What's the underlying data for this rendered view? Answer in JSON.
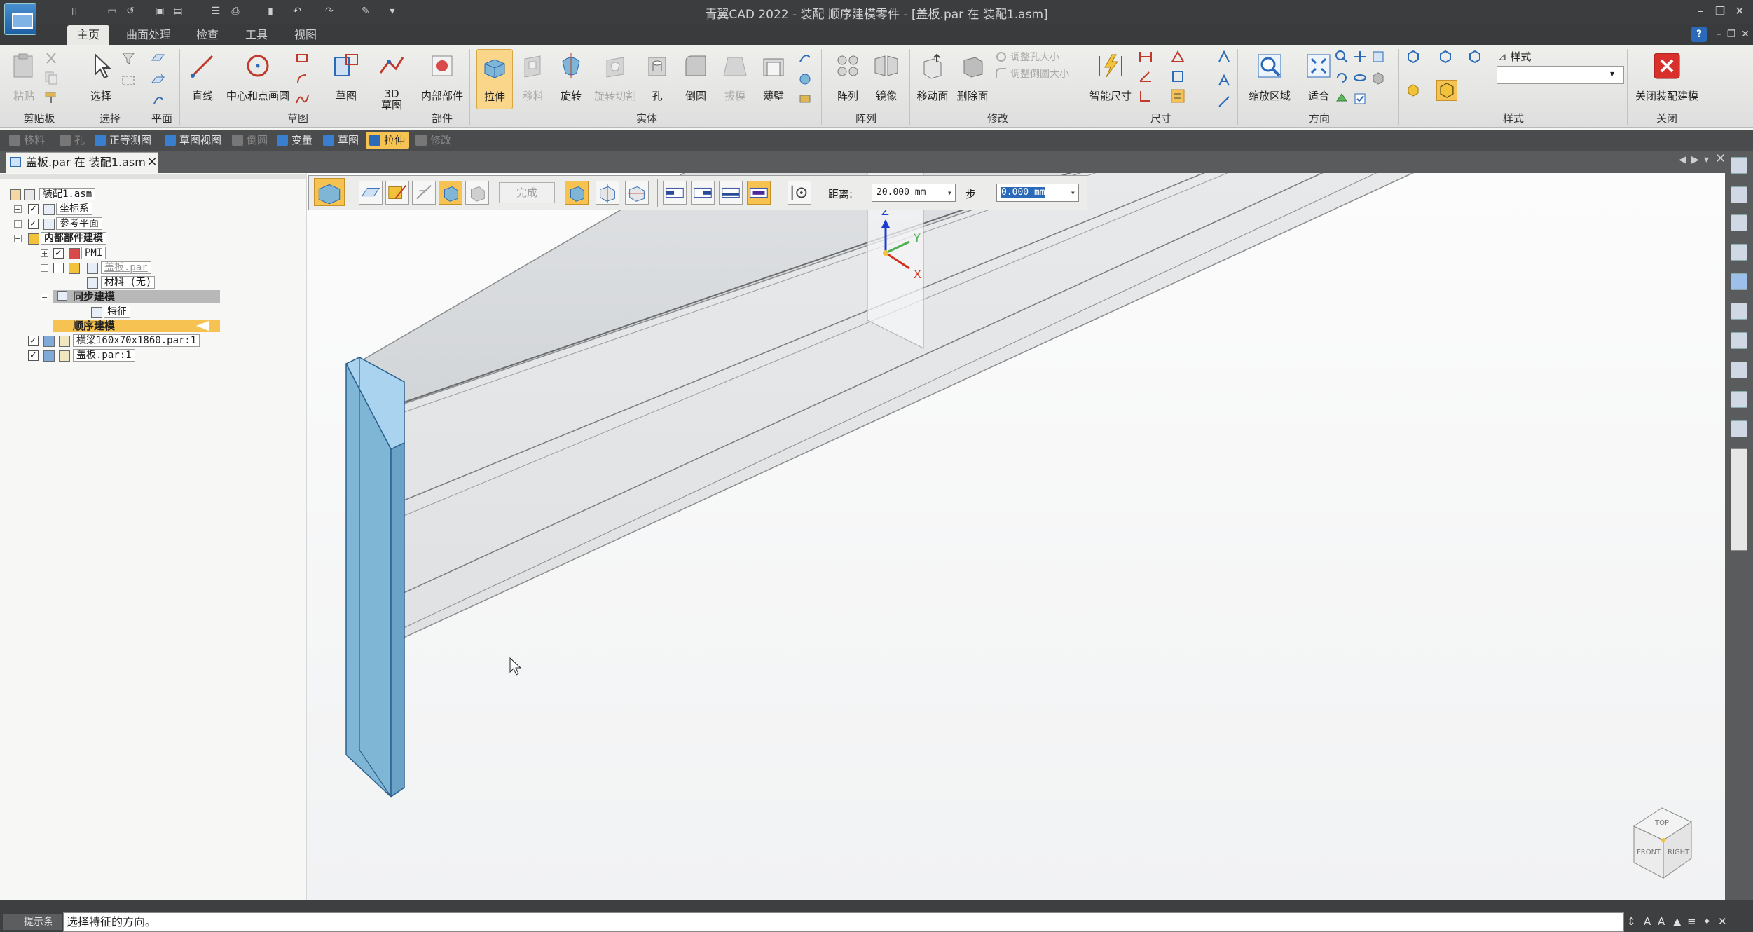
{
  "title_bar": {
    "title": "青翼CAD 2022 - 装配 顺序建模零件 - [盖板.par 在 装配1.asm]",
    "controls": [
      "–",
      "❐",
      "✕"
    ],
    "inner_controls": [
      "–",
      "❐",
      "✕"
    ]
  },
  "ribbon_tabs": [
    {
      "label": "主页",
      "active": true
    },
    {
      "label": "曲面处理"
    },
    {
      "label": "检查"
    },
    {
      "label": "工具"
    },
    {
      "label": "视图"
    }
  ],
  "ribbon": {
    "clipboard": {
      "group": "剪贴板",
      "paste": "粘贴"
    },
    "select": {
      "group": "选择",
      "select": "选择"
    },
    "plane": {
      "group": "平面"
    },
    "sketch_group": {
      "group": "草图",
      "line": "直线",
      "center_circle": "中心和点画圆",
      "sketch": "草图",
      "sketch3d": "3D\n草图"
    },
    "component": {
      "group": "部件",
      "internal": "内部部件"
    },
    "solid": {
      "group": "实体",
      "extrude": "拉伸",
      "loft": "移料",
      "revolve": "旋转",
      "revolve_cut": "旋转切割",
      "hole": "孔",
      "round": "倒圆",
      "draft": "拔模",
      "thin_wall": "薄壁"
    },
    "pattern": {
      "group": "阵列",
      "pattern": "阵列",
      "mirror": "镜像"
    },
    "modify": {
      "group": "修改",
      "move_face": "移动面",
      "delete_face": "删除面",
      "resize_hole": "调整孔大小",
      "resize_round": "调整倒圆大小"
    },
    "dimension": {
      "group": "尺寸",
      "smart_dim": "智能尺寸"
    },
    "orient": {
      "group": "方向",
      "zoom_area": "缩放区域",
      "fit": "适合"
    },
    "style": {
      "group": "样式",
      "style_label": "样式",
      "style_value": ""
    },
    "close": {
      "group": "关闭",
      "close_assembly_modeling": "关闭装配建模"
    }
  },
  "command_bar": [
    {
      "label": "移料",
      "enabled": false
    },
    {
      "label": "孔",
      "enabled": false
    },
    {
      "label": "正等测图",
      "enabled": true
    },
    {
      "label": "草图视图",
      "enabled": true
    },
    {
      "label": "倒圆",
      "enabled": false
    },
    {
      "label": "变量",
      "enabled": true
    },
    {
      "label": "草图",
      "enabled": true
    },
    {
      "label": "拉伸",
      "enabled": true,
      "active": true
    },
    {
      "label": "修改",
      "enabled": false
    }
  ],
  "document_tab": {
    "label": "盖板.par 在 装配1.asm"
  },
  "tree": {
    "root": "装配1.asm",
    "coord": "坐标系",
    "ref_planes": "参考平面",
    "internal": "内部部件建模",
    "pmi": "PMI",
    "part": "盖板.par",
    "material": "材料 (无)",
    "sync": "同步建模",
    "feature": "特征",
    "ordered": "顺序建模",
    "beam": "横梁160x70x1860.par:1",
    "cover": "盖板.par:1"
  },
  "quickbar": {
    "finish": "完成",
    "distance_label": "距离:",
    "distance_value": "20.000 mm",
    "step_label": "步",
    "step_value": "0.000 mm"
  },
  "axes": {
    "x": "X",
    "y": "Y",
    "z": "Z"
  },
  "view_cube": {
    "top": "TOP",
    "front": "FRONT",
    "right": "RIGHT"
  },
  "prompt": {
    "label": "提示条",
    "text": "选择特征的方向。"
  },
  "colors": {
    "accent": "#f6c353",
    "title_bg": "#3c3d3f",
    "selection_face": "#7fb6d6"
  }
}
